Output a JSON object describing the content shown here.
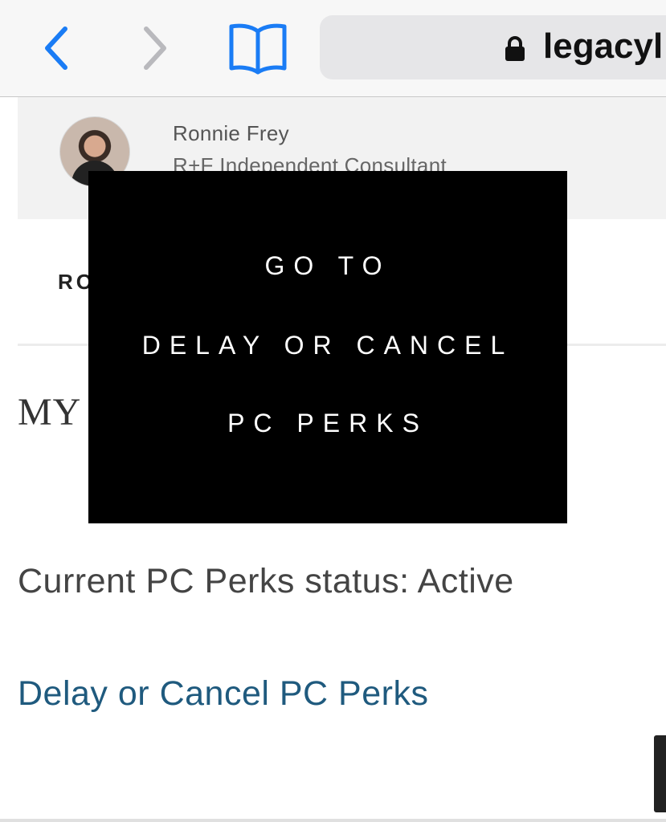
{
  "browser": {
    "url": "legacyl",
    "back_icon": "chevron-left-icon",
    "forward_icon": "chevron-right-icon",
    "bookmarks_icon": "book-icon",
    "lock_icon": "lock-icon",
    "accent": "#1a7cf5"
  },
  "consultant": {
    "name": "Ronnie Frey",
    "title": "R+F Independent Consultant"
  },
  "page": {
    "nav_fragment": "RO",
    "heading_fragment": "MY",
    "status_text": "Current PC Perks status: Active",
    "link_text": "Delay or Cancel PC Perks",
    "link_color": "#1f5a7e"
  },
  "overlay": {
    "line1": "GO TO",
    "line2": "DELAY OR CANCEL",
    "line3": "PC PERKS"
  }
}
